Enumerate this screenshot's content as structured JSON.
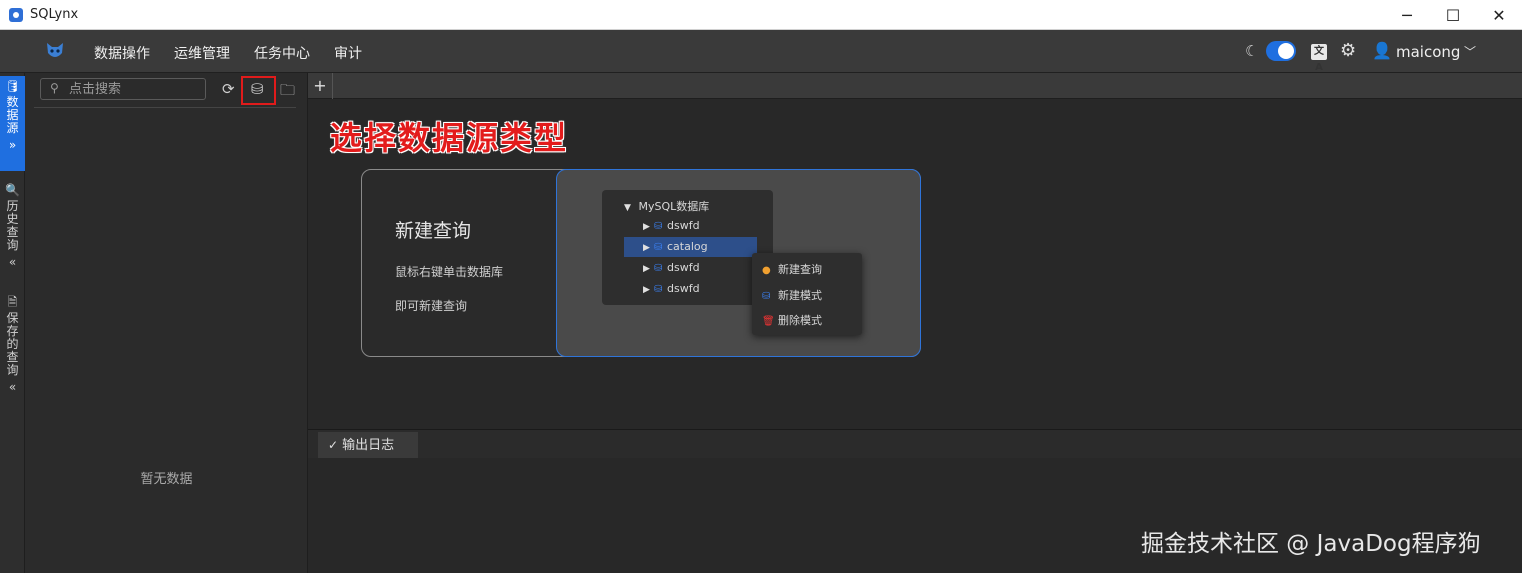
{
  "window": {
    "title": "SQLynx",
    "minimize": "─",
    "maximize": "☐",
    "close": "✕"
  },
  "nav": {
    "items": [
      "数据操作",
      "运维管理",
      "任务中心",
      "审计"
    ],
    "moon_icon": "☾",
    "translate_icon": "文A",
    "settings_icon": "⚙",
    "user_icon": "👤",
    "username": "maicong",
    "chevron": "﹀"
  },
  "sidebar_tabs": [
    {
      "label": "数据源",
      "icon": "🛢",
      "arrow": "»",
      "active": true
    },
    {
      "label": "历史查询",
      "icon": "🔍",
      "arrow": "«",
      "active": false
    },
    {
      "label": "保存的查询",
      "icon": "🗎",
      "arrow": "«",
      "active": false
    }
  ],
  "left_panel": {
    "search_placeholder": "点击搜索",
    "search_icon": "⚲",
    "refresh_icon": "⟳",
    "new_datasource_icon": "⛁",
    "new_folder_icon": "🗀",
    "empty_text": "暂无数据"
  },
  "tabs": {
    "add_label": "+"
  },
  "annotation": {
    "headline": "选择数据源类型"
  },
  "card": {
    "title": "新建查询",
    "desc1": "鼠标右键单击数据库",
    "desc2": "即可新建查询",
    "tree": {
      "root": "MySQL数据库",
      "children": [
        "dswfd",
        "catalog",
        "dswfd",
        "dswfd"
      ]
    },
    "context_menu": [
      "新建查询",
      "新建模式",
      "删除模式"
    ]
  },
  "output": {
    "tab_label": "输出日志",
    "tab_icon": "✓"
  },
  "watermark": "掘金技术社区 @ JavaDog程序狗",
  "colors": {
    "accent": "#1f6fe0",
    "highlight": "#e01b1b"
  }
}
